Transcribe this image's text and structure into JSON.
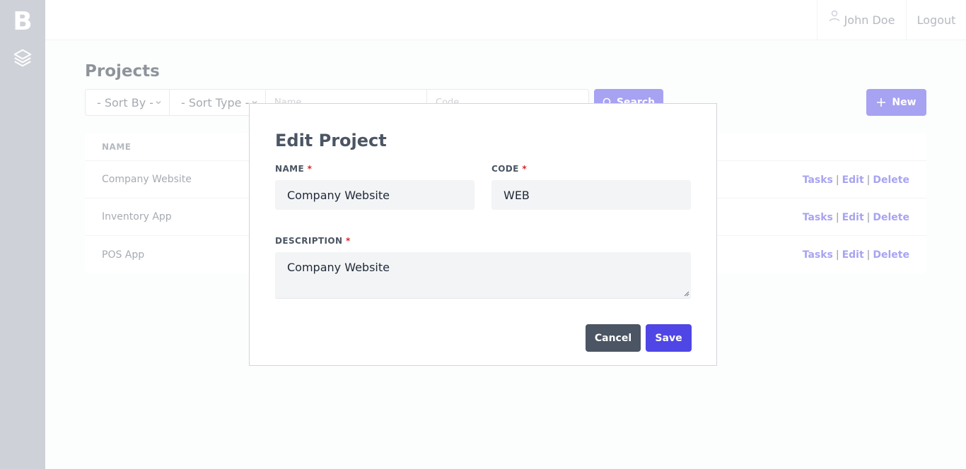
{
  "sidebar": {
    "logo": "B",
    "nav_icon": "layers-icon"
  },
  "header": {
    "user_name": "John Doe",
    "user_icon": "user-icon",
    "logout_label": "Logout"
  },
  "page": {
    "title": "Projects",
    "filters": {
      "sort_by": "- Sort By -",
      "sort_type": "- Sort Type -",
      "name_placeholder": "Name",
      "code_placeholder": "Code"
    },
    "search_label": "Search",
    "new_label": "New",
    "table": {
      "column_name": "NAME",
      "rows": [
        {
          "name": "Company Website"
        },
        {
          "name": "Inventory App"
        },
        {
          "name": "POS App"
        }
      ],
      "actions": {
        "tasks": "Tasks",
        "edit": "Edit",
        "delete": "Delete",
        "separator": "|"
      }
    }
  },
  "modal": {
    "title": "Edit Project",
    "name_label": "NAME",
    "code_label": "CODE",
    "description_label": "DESCRIPTION",
    "required_mark": "*",
    "name_value": "Company Website",
    "code_value": "WEB",
    "description_value": "Company Website",
    "cancel_label": "Cancel",
    "save_label": "Save"
  },
  "colors": {
    "accent": "#4f46e5",
    "sidebar": "#9ca3af",
    "cancel": "#4b5563",
    "required": "#dc2626"
  }
}
